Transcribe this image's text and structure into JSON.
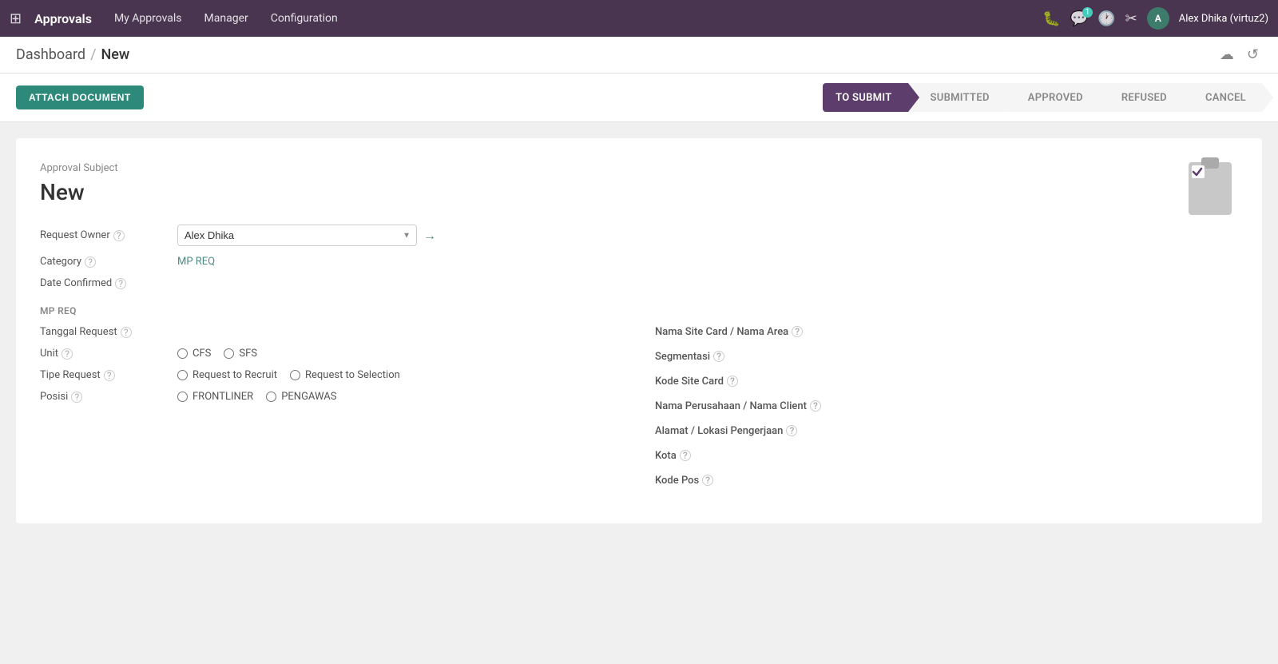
{
  "topnav": {
    "app_name": "Approvals",
    "menu_items": [
      "My Approvals",
      "Manager",
      "Configuration"
    ],
    "notification_count": "1",
    "username": "Alex Dhika (virtuz2)"
  },
  "breadcrumb": {
    "parent": "Dashboard",
    "separator": "/",
    "current": "New"
  },
  "toolbar": {
    "attach_label": "ATTACH DOCUMENT"
  },
  "status_pipeline": [
    {
      "label": "TO SUBMIT",
      "active": true
    },
    {
      "label": "SUBMITTED",
      "active": false
    },
    {
      "label": "APPROVED",
      "active": false
    },
    {
      "label": "REFUSED",
      "active": false
    },
    {
      "label": "CANCEL",
      "active": false
    }
  ],
  "form": {
    "approval_subject_label": "Approval Subject",
    "title": "New",
    "fields": {
      "request_owner_label": "Request Owner",
      "request_owner_value": "Alex Dhika",
      "category_label": "Category",
      "category_value": "MP REQ",
      "date_confirmed_label": "Date Confirmed"
    },
    "section_label": "MP REQ",
    "tanggal_request_label": "Tanggal Request",
    "unit_label": "Unit",
    "unit_options": [
      "CFS",
      "SFS"
    ],
    "tipe_request_label": "Tipe Request",
    "tipe_request_options": [
      "Request to Recruit",
      "Request to Selection"
    ],
    "posisi_label": "Posisi",
    "posisi_options": [
      "FRONTLINER",
      "PENGAWAS"
    ],
    "right_fields": [
      "Nama Site Card / Nama Area",
      "Segmentasi",
      "Kode Site Card",
      "Nama Perusahaan / Nama Client",
      "Alamat / Lokasi Pengerjaan",
      "Kota",
      "Kode Pos"
    ]
  }
}
